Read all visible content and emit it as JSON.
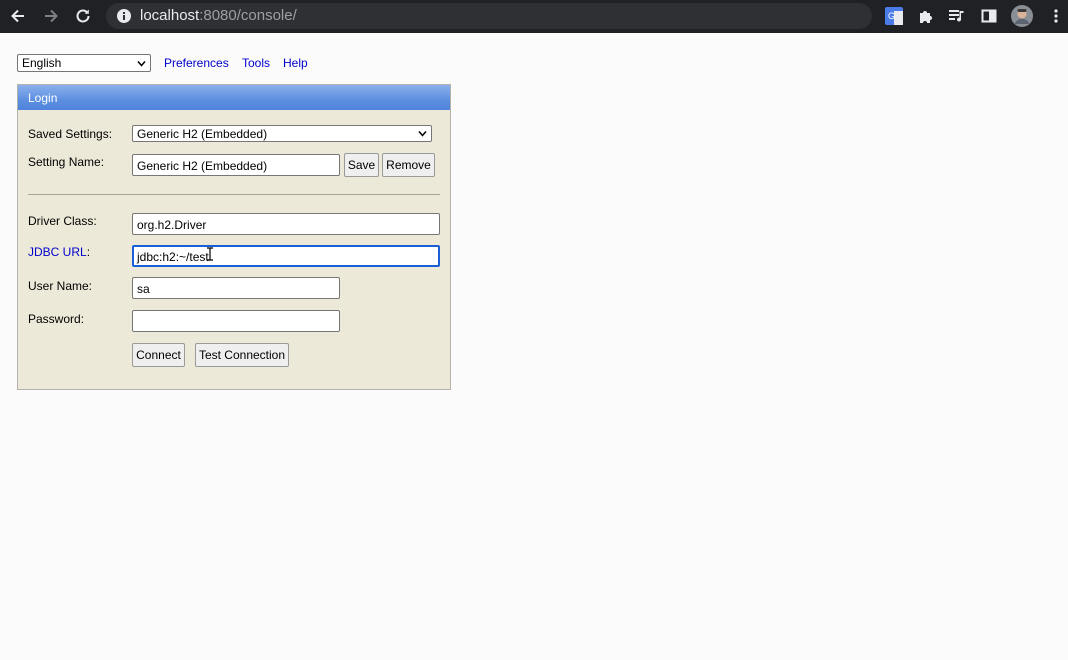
{
  "browser": {
    "url_host": "localhost",
    "url_rest": ":8080/console/"
  },
  "topbar": {
    "language": "English",
    "links": [
      "Preferences",
      "Tools",
      "Help"
    ]
  },
  "login": {
    "title": "Login",
    "saved_settings_label": "Saved Settings:",
    "saved_settings_value": "Generic H2 (Embedded)",
    "setting_name_label": "Setting Name:",
    "setting_name_value": "Generic H2 (Embedded)",
    "save_label": "Save",
    "remove_label": "Remove",
    "driver_class_label": "Driver Class:",
    "driver_class_value": "org.h2.Driver",
    "jdbc_url_label": "JDBC URL",
    "jdbc_url_colon": ":",
    "jdbc_url_value": "jdbc:h2:~/test",
    "user_name_label": "User Name:",
    "user_name_value": "sa",
    "password_label": "Password:",
    "password_value": "",
    "connect_label": "Connect",
    "test_connection_label": "Test Connection"
  },
  "colors": {
    "link": "#0000cc",
    "panel_bg": "#ece9d8",
    "header_blue": "#5c8fe0",
    "focus_blue": "#1a5fd6",
    "chrome_dark": "#202124"
  }
}
